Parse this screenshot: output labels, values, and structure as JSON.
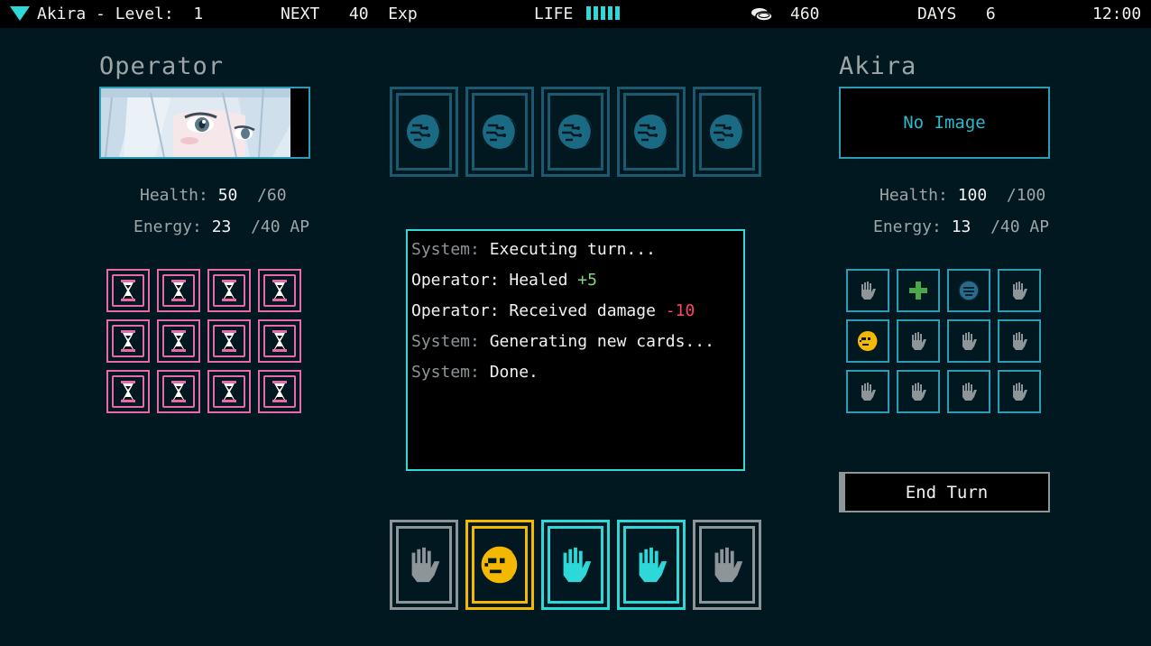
{
  "topbar": {
    "player_level": "Akira - Level:  1",
    "next_exp": "NEXT   40  Exp",
    "life_label": "LIFE",
    "life_bars": 5,
    "coins": "460",
    "days": "DAYS   6",
    "time": "12:00"
  },
  "operator": {
    "title": "Operator",
    "health_label": "Health:",
    "health_value": "50",
    "health_max": " /60",
    "energy_label": "Energy:",
    "energy_value": "23",
    "energy_max": " /40 AP"
  },
  "akira": {
    "title": "Akira",
    "no_image": "No Image",
    "health_label": "Health:",
    "health_value": "100",
    "health_max": " /100",
    "energy_label": "Energy:",
    "energy_value": "13",
    "energy_max": " /40 AP"
  },
  "log": [
    {
      "source": "System:",
      "message": " Executing turn...",
      "source_type": "system"
    },
    {
      "source": "Operator:",
      "message": " Healed ",
      "delta": "+5",
      "delta_type": "pos",
      "source_type": "operator"
    },
    {
      "source": "Operator:",
      "message": " Received damage ",
      "delta": "-10",
      "delta_type": "neg",
      "source_type": "operator"
    },
    {
      "source": "System:",
      "message": " Generating new cards...",
      "source_type": "system"
    },
    {
      "source": "System:",
      "message": " Done.",
      "source_type": "system"
    }
  ],
  "end_turn_label": "End Turn",
  "colors": {
    "accent_cyan": "#2fd8d8",
    "frame_blue": "#2a9db5",
    "pink": "#e86aa8",
    "gold": "#f5b800",
    "grey": "#8e9598"
  },
  "enemy_deck": [
    "moon-card-icon",
    "moon-card-icon",
    "moon-card-icon",
    "moon-card-icon",
    "moon-card-icon"
  ],
  "operator_grid": [
    "hourglass-icon",
    "hourglass-icon",
    "hourglass-icon",
    "hourglass-icon",
    "hourglass-icon",
    "hourglass-icon",
    "hourglass-icon",
    "hourglass-icon",
    "hourglass-icon",
    "hourglass-icon",
    "hourglass-icon",
    "hourglass-icon"
  ],
  "akira_grid": [
    "hand-icon",
    "plus-icon",
    "face-icon",
    "hand-icon",
    "moon-face-icon",
    "hand-icon",
    "hand-icon",
    "hand-icon",
    "hand-icon",
    "hand-icon",
    "hand-icon",
    "hand-icon"
  ],
  "hand": [
    {
      "icon": "hand-icon",
      "color": "grey"
    },
    {
      "icon": "moon-face-icon",
      "color": "gold"
    },
    {
      "icon": "hand-icon",
      "color": "cyan"
    },
    {
      "icon": "hand-icon",
      "color": "cyan"
    },
    {
      "icon": "hand-icon",
      "color": "grey"
    }
  ]
}
